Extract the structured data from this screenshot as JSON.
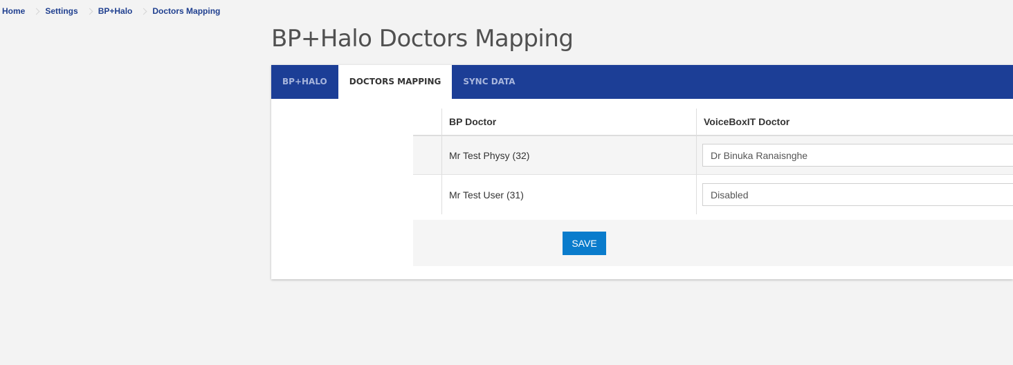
{
  "breadcrumb": {
    "items": [
      "Home",
      "Settings",
      "BP+Halo",
      "Doctors Mapping"
    ]
  },
  "page": {
    "title": "BP+Halo Doctors Mapping"
  },
  "tabs": [
    {
      "label": "BP+HALO",
      "active": false
    },
    {
      "label": "DOCTORS MAPPING",
      "active": true
    },
    {
      "label": "SYNC DATA",
      "active": false
    }
  ],
  "table": {
    "columns": [
      "BP Doctor",
      "VoiceBoxIT Doctor"
    ],
    "rows": [
      {
        "bp_doctor": "Mr Test Physy (32)",
        "voicebox_doctor": "Dr Binuka Ranaisnghe"
      },
      {
        "bp_doctor": "Mr Test User (31)",
        "voicebox_doctor": "Disabled"
      }
    ]
  },
  "actions": {
    "save_label": "SAVE"
  },
  "colors": {
    "tabbar": "#1c3e96",
    "link": "#1f3f8f",
    "save_button": "#0a7ccc",
    "background": "#f3f3f3"
  }
}
